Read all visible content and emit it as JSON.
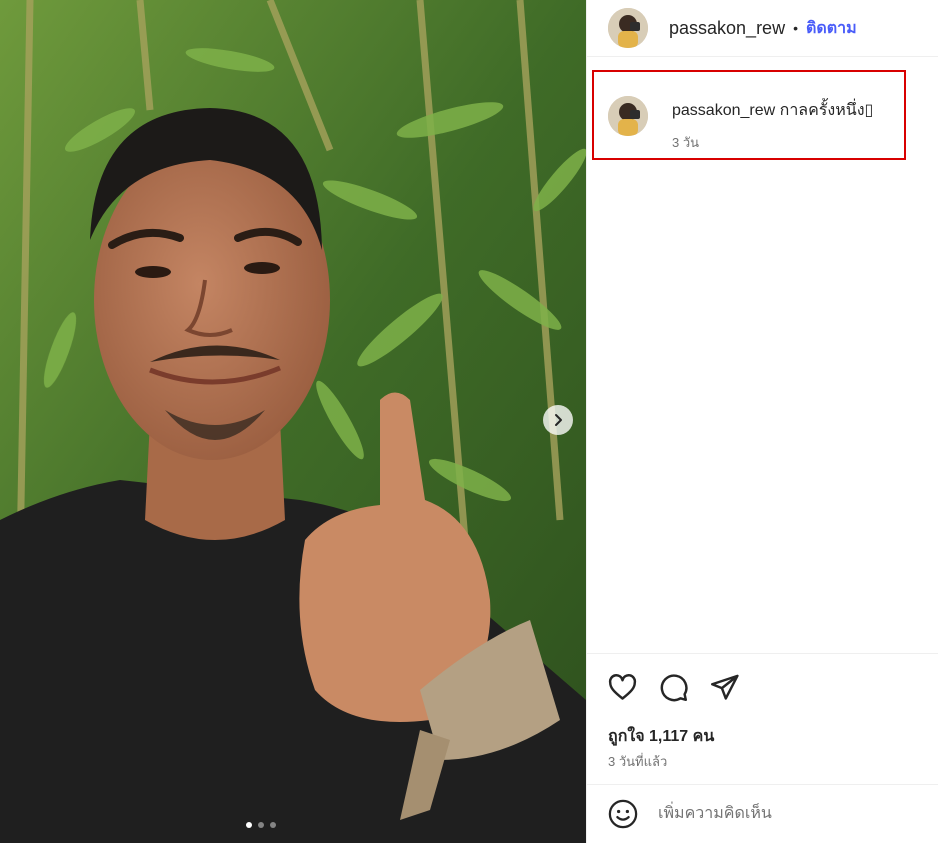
{
  "post": {
    "photo_alt": "passakon_rew photo",
    "carousel": {
      "total": 3,
      "active_index": 0
    }
  },
  "header": {
    "username": "passakon_rew",
    "separator": "•",
    "follow_label": "ติดตาม"
  },
  "caption": {
    "username": "passakon_rew",
    "text": "กาลครั้งหนึ่ง▯",
    "time": "3 วัน"
  },
  "actions": {
    "like_icon": "heart-icon",
    "comment_icon": "comment-icon",
    "share_icon": "share-icon"
  },
  "likes_label": "ถูกใจ 1,117 คน",
  "date_label": "3 วันที่แล้ว",
  "comment": {
    "emoji_icon": "emoji-icon",
    "placeholder": "เพิ่มความคิดเห็น"
  },
  "colors": {
    "follow_blue": "#4a5df9",
    "highlight_red": "#d80000",
    "muted_text": "#737373"
  }
}
